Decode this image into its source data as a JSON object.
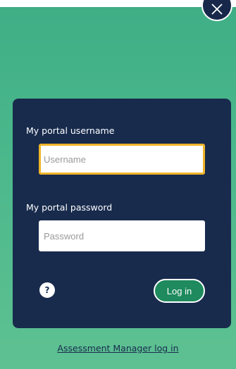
{
  "modal": {
    "close_icon": "close-icon"
  },
  "login_form": {
    "username_label": "My portal username",
    "username_placeholder": "Username",
    "password_label": "My portal password",
    "password_placeholder": "Password",
    "help_label": "?",
    "login_label": "Log in"
  },
  "footer": {
    "manager_link": "Assessment Manager log in"
  },
  "colors": {
    "background_green": "#4cb88c",
    "panel_navy": "#182b4d",
    "focus_border": "#f0b429",
    "button_green": "#1e8a5e"
  }
}
